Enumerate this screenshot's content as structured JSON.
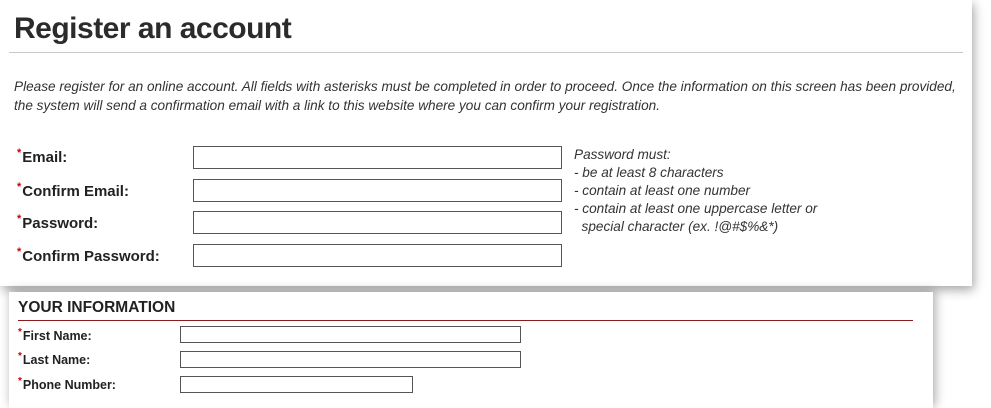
{
  "page": {
    "title": "Register an account",
    "intro": "Please register for an online account. All fields with asterisks must be completed in order to proceed. Once the information on this screen has been provided, the system will send a confirmation email with a link to this website where you can confirm your registration."
  },
  "required_marker": "*",
  "account": {
    "email_label": "Email:",
    "confirm_email_label": "Confirm Email:",
    "password_label": "Password:",
    "confirm_password_label": "Confirm Password:",
    "email_value": "",
    "confirm_email_value": "",
    "password_value": "",
    "confirm_password_value": ""
  },
  "password_rules": {
    "heading": "Password must:",
    "items": [
      "- be at least 8 characters",
      "- contain at least one number",
      "- contain at least one uppercase letter or",
      "  special character (ex. !@#$%&*)"
    ]
  },
  "your_information": {
    "section_title": "YOUR INFORMATION",
    "first_name_label": "First Name:",
    "last_name_label": "Last Name:",
    "phone_label": "Phone Number:",
    "first_name_value": "",
    "last_name_value": "",
    "phone_value": ""
  },
  "colors": {
    "required": "#cc0000",
    "section_rule": "#8b1a1a",
    "text": "#222222"
  }
}
